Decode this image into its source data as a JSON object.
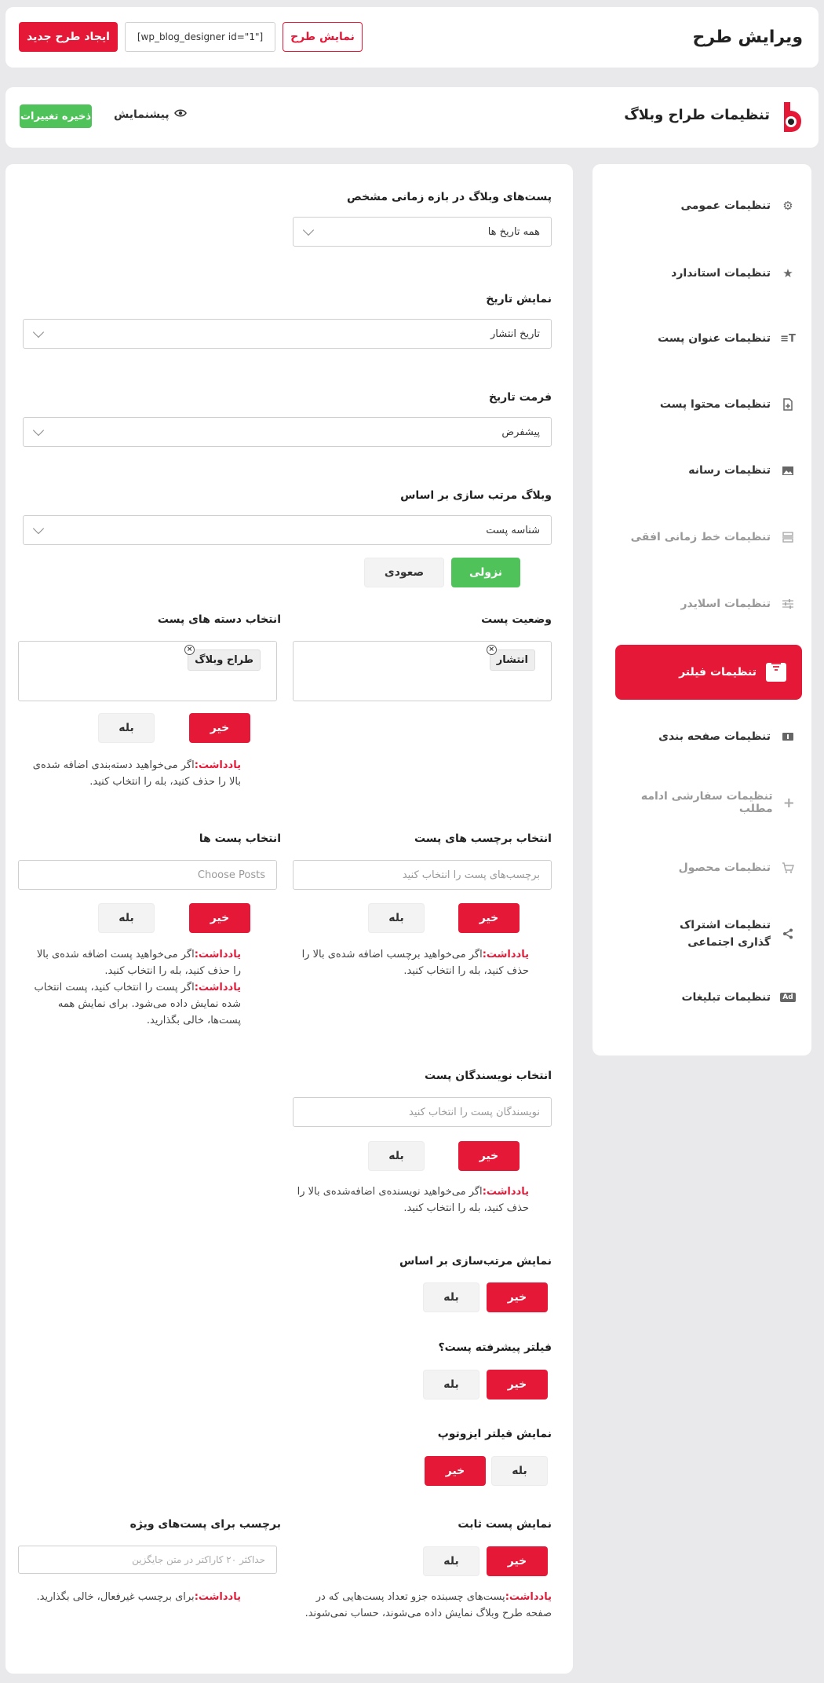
{
  "header": {
    "title": "ویرایش طرح",
    "preview_button": "نمایش طرح",
    "shortcode": "[wp_blog_designer id=\"1\"]",
    "create_button": "ایجاد طرح جدید"
  },
  "subheader": {
    "title": "تنظیمات طراح وبلاگ",
    "preview_link": "پیشنمایش",
    "save_button": "ذخیره تغییرات"
  },
  "sidebar": {
    "items": [
      {
        "label": "تنظیمات عمومی",
        "icon": "gear-icon"
      },
      {
        "label": "تنظیمات استاندارد",
        "icon": "star-settings-icon"
      },
      {
        "label": "تنظیمات عنوان پست",
        "icon": "text-title-icon"
      },
      {
        "label": "تنظیمات محتوا پست",
        "icon": "file-plus-icon"
      },
      {
        "label": "تنظیمات رسانه",
        "icon": "image-icon"
      },
      {
        "label": "تنظیمات خط زمانی افقی",
        "icon": "timeline-icon"
      },
      {
        "label": "تنظیمات اسلایدر",
        "icon": "sliders-icon"
      },
      {
        "label": "تنظیمات فیلتر",
        "icon": "filter-icon"
      },
      {
        "label": "تنظیمات صفحه بندی",
        "icon": "pagination-icon"
      },
      {
        "label": "تنظیمات سفارشی ادامه مطلب",
        "icon": "plus-icon"
      },
      {
        "label": "تنظیمات محصول",
        "icon": "cart-icon"
      },
      {
        "label": "تنظیمات اشتراک گذاری اجتماعی",
        "icon": "share-icon"
      },
      {
        "label": "تنظیمات تبلیغات",
        "icon": "ad-icon"
      }
    ]
  },
  "form": {
    "date_range": {
      "label": "پست‌های وبلاگ در بازه زمانی مشخص",
      "value": "همه تاریخ ها"
    },
    "show_date": {
      "label": "نمایش تاریخ",
      "value": "تاریخ انتشار"
    },
    "date_format": {
      "label": "فرمت تاریخ",
      "value": "پیشفرض"
    },
    "order_by": {
      "label": "وبلاگ مرتب سازی بر اساس",
      "value": "شناسه پست",
      "desc": "نزولی",
      "asc": "صعودی"
    },
    "post_status": {
      "label": "وضعیت پست",
      "tag": "انتشار"
    },
    "categories": {
      "label": "انتخاب دسته های پست",
      "tag": "طراح وبلاگ",
      "no": "خیر",
      "yes": "بله",
      "note_key": "یادداشت:",
      "note": "اگر می‌خواهید دسته‌بندی اضافه شده‌ی بالا را حذف کنید، بله را انتخاب کنید."
    },
    "tags": {
      "label": "انتخاب برچسب های پست",
      "placeholder": "برچسب‌های پست را انتخاب کنید",
      "no": "خیر",
      "yes": "بله",
      "note_key": "یادداشت:",
      "note": "اگر می‌خواهید برچسب اضافه شده‌ی بالا را حذف کنید، بله را انتخاب کنید."
    },
    "posts": {
      "label": "انتخاب پست ها",
      "placeholder": "Choose Posts",
      "no": "خیر",
      "yes": "بله",
      "note_key": "یادداشت:",
      "note": "اگر می‌خواهید پست اضافه شده‌ی بالا را حذف کنید، بله را انتخاب کنید.",
      "note2_key": "یادداشت:",
      "note2": "اگر پست را انتخاب کنید، پست انتخاب شده نمایش داده می‌شود. برای نمایش همه پست‌ها، خالی بگذارید."
    },
    "authors": {
      "label": "انتخاب نویسندگان پست",
      "placeholder": "نویسندگان پست را انتخاب کنید",
      "no": "خیر",
      "yes": "بله",
      "note_key": "یادداشت:",
      "note": "اگر می‌خواهید نویسنده‌ی اضافه‌شده‌ی بالا را حذف کنید، بله را انتخاب کنید."
    },
    "show_sort": {
      "label": "نمایش مرتب‌سازی بر اساس",
      "no": "خیر",
      "yes": "بله"
    },
    "advanced_filter": {
      "label": "فیلتر پیشرفته پست؟",
      "no": "خیر",
      "yes": "بله"
    },
    "isotope": {
      "label": "نمایش فیلتر ایزوتوپ",
      "yes": "بله",
      "no": "خیر"
    },
    "sticky": {
      "label": "نمایش پست ثابت",
      "no": "خیر",
      "yes": "بله",
      "note_key": "یادداشت:",
      "note": "پست‌های چسبنده جزو تعداد پست‌هایی که در صفحه طرح وبلاگ نمایش داده می‌شوند، حساب نمی‌شوند."
    },
    "featured_label": {
      "label": "برچسب برای پست‌های ویژه",
      "placeholder": "حداکثر ۲۰ کاراکتر در متن جایگزین",
      "note_key": "یادداشت:",
      "note": "برای برچسب غیرفعال، خالی بگذارید."
    }
  },
  "colors": {
    "accent": "#e51937",
    "save": "#4fc35a"
  }
}
